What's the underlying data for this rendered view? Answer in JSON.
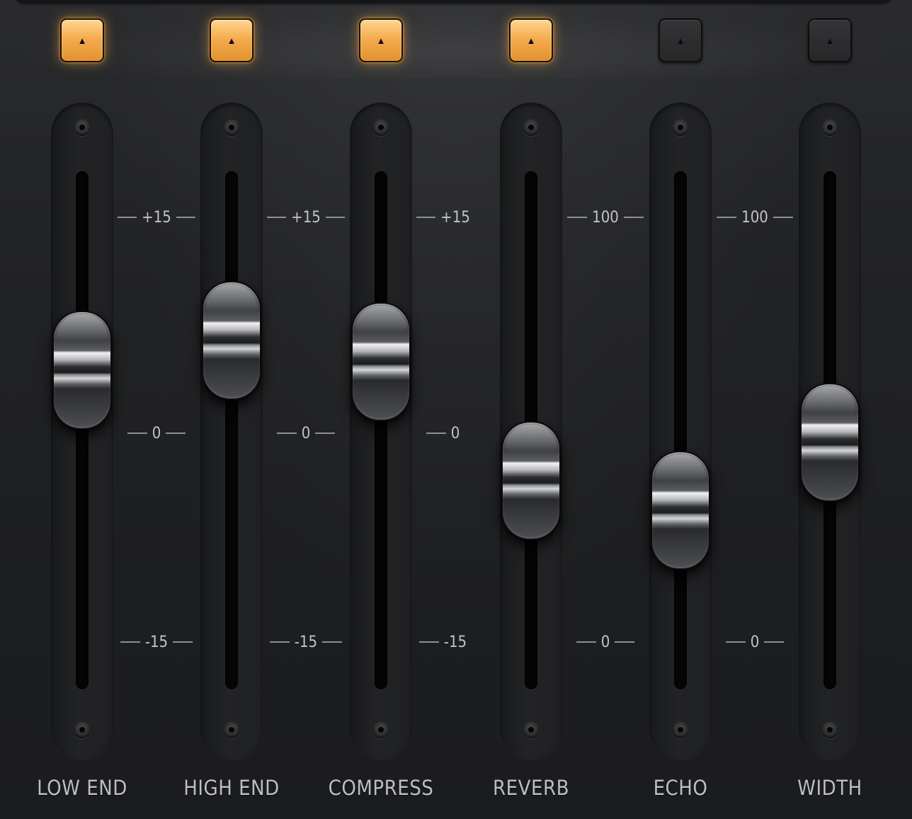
{
  "toggle_icon": "triangle-up-icon",
  "accent_color": "#f4aa4c",
  "channels": [
    {
      "label": "LOW END",
      "enabled": true,
      "toggle_glyph": "▲",
      "scale": {
        "top": "+15",
        "mid": "0",
        "bottom": "-15"
      }
    },
    {
      "label": "HIGH END",
      "enabled": true,
      "toggle_glyph": "▲",
      "scale": {
        "top": "+15",
        "mid": "0",
        "bottom": "-15"
      }
    },
    {
      "label": "COMPRESS",
      "enabled": true,
      "toggle_glyph": "▲",
      "scale": {
        "top": "+15",
        "mid": "0",
        "bottom": "-15"
      }
    },
    {
      "label": "REVERB",
      "enabled": true,
      "toggle_glyph": "▲",
      "scale": {
        "top": "100",
        "mid": "",
        "bottom": "0"
      }
    },
    {
      "label": "ECHO",
      "enabled": false,
      "toggle_glyph": "▲",
      "scale": {
        "top": "100",
        "mid": "",
        "bottom": "0"
      }
    },
    {
      "label": "WIDTH",
      "enabled": false,
      "toggle_glyph": "▲",
      "scale": {
        "top": "100",
        "mid": "",
        "bottom": "0"
      }
    }
  ],
  "slider_levels": [
    0.64,
    0.71,
    0.66,
    0.38,
    0.31,
    0.47
  ]
}
